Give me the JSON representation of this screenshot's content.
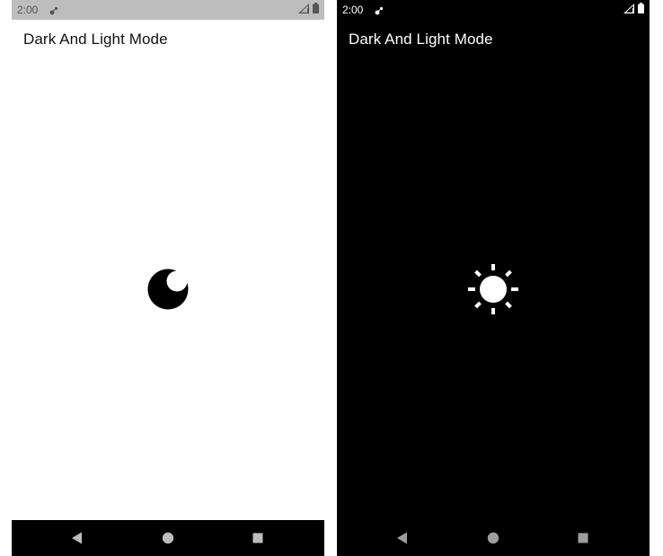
{
  "screens": [
    {
      "mode": "light",
      "status_time": "2:00",
      "title": "Dark And Light Mode",
      "toggle_icon": "moon-icon",
      "background": "#ffffff",
      "foreground": "#000000"
    },
    {
      "mode": "dark",
      "status_time": "2:00",
      "title": "Dark And Light Mode",
      "toggle_icon": "sun-icon",
      "background": "#000000",
      "foreground": "#ffffff"
    }
  ],
  "nav_icons": [
    "back-icon",
    "home-icon",
    "recents-icon"
  ]
}
